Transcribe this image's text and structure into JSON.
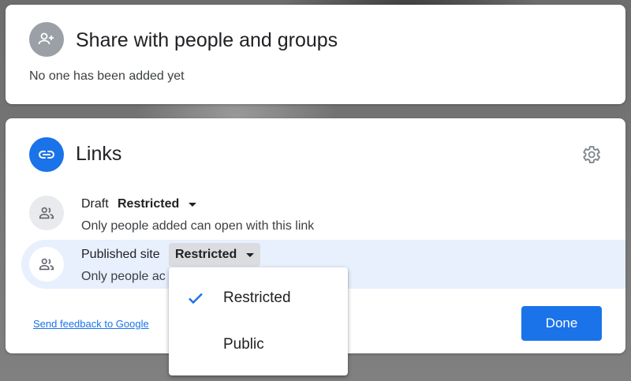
{
  "share": {
    "title": "Share with people and groups",
    "empty_text": "No one has been added yet",
    "icon": "add-person-icon"
  },
  "links": {
    "title": "Links",
    "icon": "link-icon",
    "settings_icon": "gear-icon",
    "rows": [
      {
        "label": "Draft",
        "access": "Restricted",
        "description": "Only people added can open with this link",
        "icon": "people-icon"
      },
      {
        "label": "Published site",
        "access": "Restricted",
        "description": "Only people ac",
        "icon": "people-icon"
      }
    ],
    "feedback_link": "Send feedback to Google",
    "done_label": "Done"
  },
  "access_menu": {
    "options": [
      {
        "label": "Restricted",
        "selected": true
      },
      {
        "label": "Public",
        "selected": false
      }
    ]
  },
  "colors": {
    "accent": "#1a73e8",
    "highlight": "#e8f0fe",
    "icon_grey": "#9aa0a6"
  }
}
